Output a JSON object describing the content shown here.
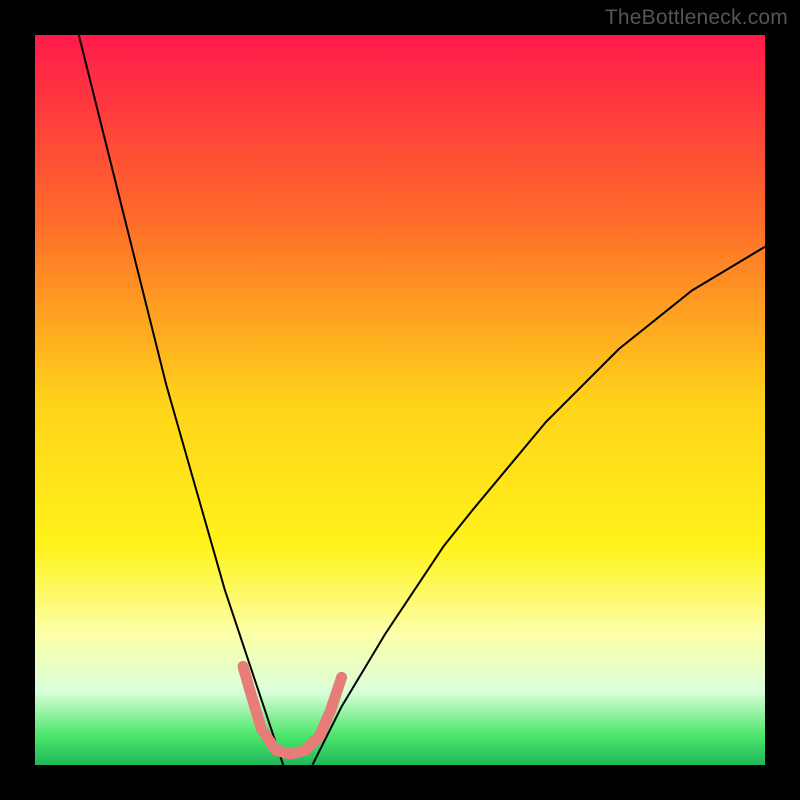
{
  "watermark": "TheBottleneck.com",
  "chart_data": {
    "type": "line",
    "title": "",
    "xlabel": "",
    "ylabel": "",
    "xlim": [
      0,
      100
    ],
    "ylim": [
      0,
      100
    ],
    "gradient_stops": [
      {
        "offset": 0.0,
        "color": "#ff1a4b"
      },
      {
        "offset": 0.25,
        "color": "#ff6a2a"
      },
      {
        "offset": 0.5,
        "color": "#ffd21a"
      },
      {
        "offset": 0.7,
        "color": "#fff31a"
      },
      {
        "offset": 0.82,
        "color": "#fcffa8"
      },
      {
        "offset": 0.9,
        "color": "#d9ffd9"
      },
      {
        "offset": 0.96,
        "color": "#4be66b"
      },
      {
        "offset": 1.0,
        "color": "#1fb85a"
      }
    ],
    "series": [
      {
        "name": "left-curve",
        "color": "#000000",
        "width": 2,
        "x": [
          6,
          8,
          10,
          12,
          14,
          16,
          18,
          20,
          22,
          24,
          26,
          28,
          30,
          32,
          33,
          34
        ],
        "y": [
          100,
          92,
          84,
          76,
          68,
          60,
          52,
          45,
          38,
          31,
          24,
          18,
          12,
          6,
          3,
          0
        ]
      },
      {
        "name": "right-curve",
        "color": "#000000",
        "width": 2,
        "x": [
          38,
          40,
          42,
          45,
          48,
          52,
          56,
          60,
          65,
          70,
          75,
          80,
          85,
          90,
          95,
          100
        ],
        "y": [
          0,
          4,
          8,
          13,
          18,
          24,
          30,
          35,
          41,
          47,
          52,
          57,
          61,
          65,
          68,
          71
        ]
      },
      {
        "name": "marker-band",
        "color": "#e77c79",
        "width": 11,
        "style": "rounded",
        "x": [
          28.5,
          29.5,
          31.0,
          33.0,
          35.0,
          37.0,
          39.0,
          40.5,
          42.0
        ],
        "y": [
          13.5,
          10.0,
          5.0,
          2.0,
          1.5,
          2.0,
          4.0,
          7.5,
          12.0
        ]
      }
    ]
  }
}
